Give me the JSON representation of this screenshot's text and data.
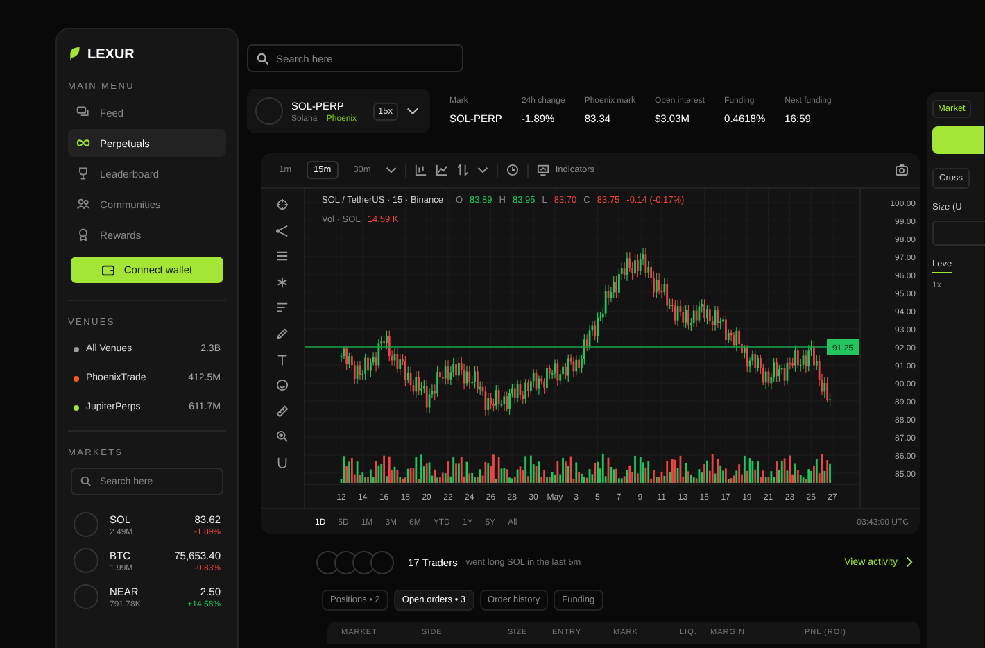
{
  "sidebar": {
    "logo": "LEXUR",
    "menu_heading": "MAIN MENU",
    "menu": [
      {
        "label": "Feed",
        "selected": false
      },
      {
        "label": "Perpetuals",
        "selected": true
      },
      {
        "label": "Leaderboard",
        "selected": false
      },
      {
        "label": "Communities",
        "selected": false
      },
      {
        "label": "Rewards",
        "selected": false
      }
    ],
    "connect_button": "Connect wallet",
    "venues_heading": "VENUES",
    "venues": [
      {
        "name": "All Venues",
        "value": "2.3B",
        "color": "#9a9a9a"
      },
      {
        "name": "PhoenixTrade",
        "value": "412.5M",
        "color": "#ff5a1f"
      },
      {
        "name": "JupiterPerps",
        "value": "611.7M",
        "color": "#a3e635"
      }
    ],
    "markets_heading": "MARKETS",
    "markets_search": {
      "placeholder": "Search here"
    },
    "markets": [
      {
        "symbol": "SOL",
        "volume": "2.49M",
        "price": "83.62",
        "change": "-1.89%",
        "color": "#ef4444"
      },
      {
        "symbol": "BTC",
        "volume": "1.99M",
        "price": "75,653.40",
        "change": "-0.83%",
        "color": "#ef4444"
      },
      {
        "symbol": "NEAR",
        "volume": "791.78K",
        "price": "2.50",
        "change": "+14.58%",
        "color": "#22c55e"
      }
    ]
  },
  "search": {
    "placeholder": "Search here"
  },
  "instrument": {
    "symbol": "SOL-PERP",
    "chain": "Solana",
    "venue": "· Phoenix",
    "leverage": "15x"
  },
  "stats": [
    {
      "label": "Mark",
      "value": "SOL-PERP"
    },
    {
      "label": "24h change",
      "value": "-1.89%"
    },
    {
      "label": "Phoenix mark",
      "value": "83.34"
    },
    {
      "label": "Open interest",
      "value": "$3.03M"
    },
    {
      "label": "Funding",
      "value": "0.4618%"
    },
    {
      "label": "Next funding",
      "value": "16:59"
    }
  ],
  "chart": {
    "timeframes": [
      {
        "label": "1m",
        "selected": false
      },
      {
        "label": "15m",
        "selected": true
      },
      {
        "label": "30m",
        "selected": false
      }
    ],
    "indicators_label": "Indicators",
    "title": "SOL / TetherUS · 15 · Binance",
    "ohlc": [
      {
        "label": "O",
        "value": "83.89",
        "color": "#22c55e"
      },
      {
        "label": "H",
        "value": "83.95",
        "color": "#22c55e"
      },
      {
        "label": "L",
        "value": "83.70",
        "color": "#ef4444"
      },
      {
        "label": "C",
        "value": "83.75",
        "color": "#ef4444"
      }
    ],
    "change": "-0.14 (-0.17%)",
    "volume_label": "Vol · SOL",
    "volume_value": "14.59 K",
    "price_axis": [
      "100.00",
      "99.00",
      "98.00",
      "97.00",
      "96.00",
      "95.00",
      "94.00",
      "93.00",
      "92.00",
      "91.00",
      "90.00",
      "89.00",
      "88.00",
      "87.00",
      "86.00",
      "85.00"
    ],
    "date_axis": [
      "12",
      "14",
      "16",
      "18",
      "20",
      "22",
      "24",
      "26",
      "28",
      "30",
      "May",
      "3",
      "5",
      "7",
      "9",
      "11",
      "13",
      "15",
      "17",
      "19",
      "21",
      "23",
      "25",
      "27"
    ],
    "price_tag": "91.25",
    "ranges": [
      {
        "label": "1D",
        "selected": true
      },
      {
        "label": "5D",
        "selected": false
      },
      {
        "label": "1M",
        "selected": false
      },
      {
        "label": "3M",
        "selected": false
      },
      {
        "label": "6M",
        "selected": false
      },
      {
        "label": "YTD",
        "selected": false
      },
      {
        "label": "1Y",
        "selected": false
      },
      {
        "label": "5Y",
        "selected": false
      },
      {
        "label": "All",
        "selected": false
      }
    ],
    "timestamp": "03:43:00 UTC"
  },
  "traders": {
    "count": "17 Traders",
    "text": "went long SOL in the last 5m",
    "link": "View activity"
  },
  "order_tabs": [
    {
      "label": "Positions • 2",
      "selected": false
    },
    {
      "label": "Open orders • 3",
      "selected": true
    },
    {
      "label": "Order history",
      "selected": false
    },
    {
      "label": "Funding",
      "selected": false
    }
  ],
  "table": {
    "columns": [
      "MARKET",
      "SIDE",
      "SIZE",
      "ENTRY",
      "MARK",
      "LIQ.",
      "MARGIN",
      "PNL (ROI)"
    ]
  },
  "order_panel": {
    "tab": "Market",
    "margin_mode": "Cross",
    "size_label": "Size (U",
    "leverage_label": "Leve",
    "leverage_value": "1x"
  }
}
